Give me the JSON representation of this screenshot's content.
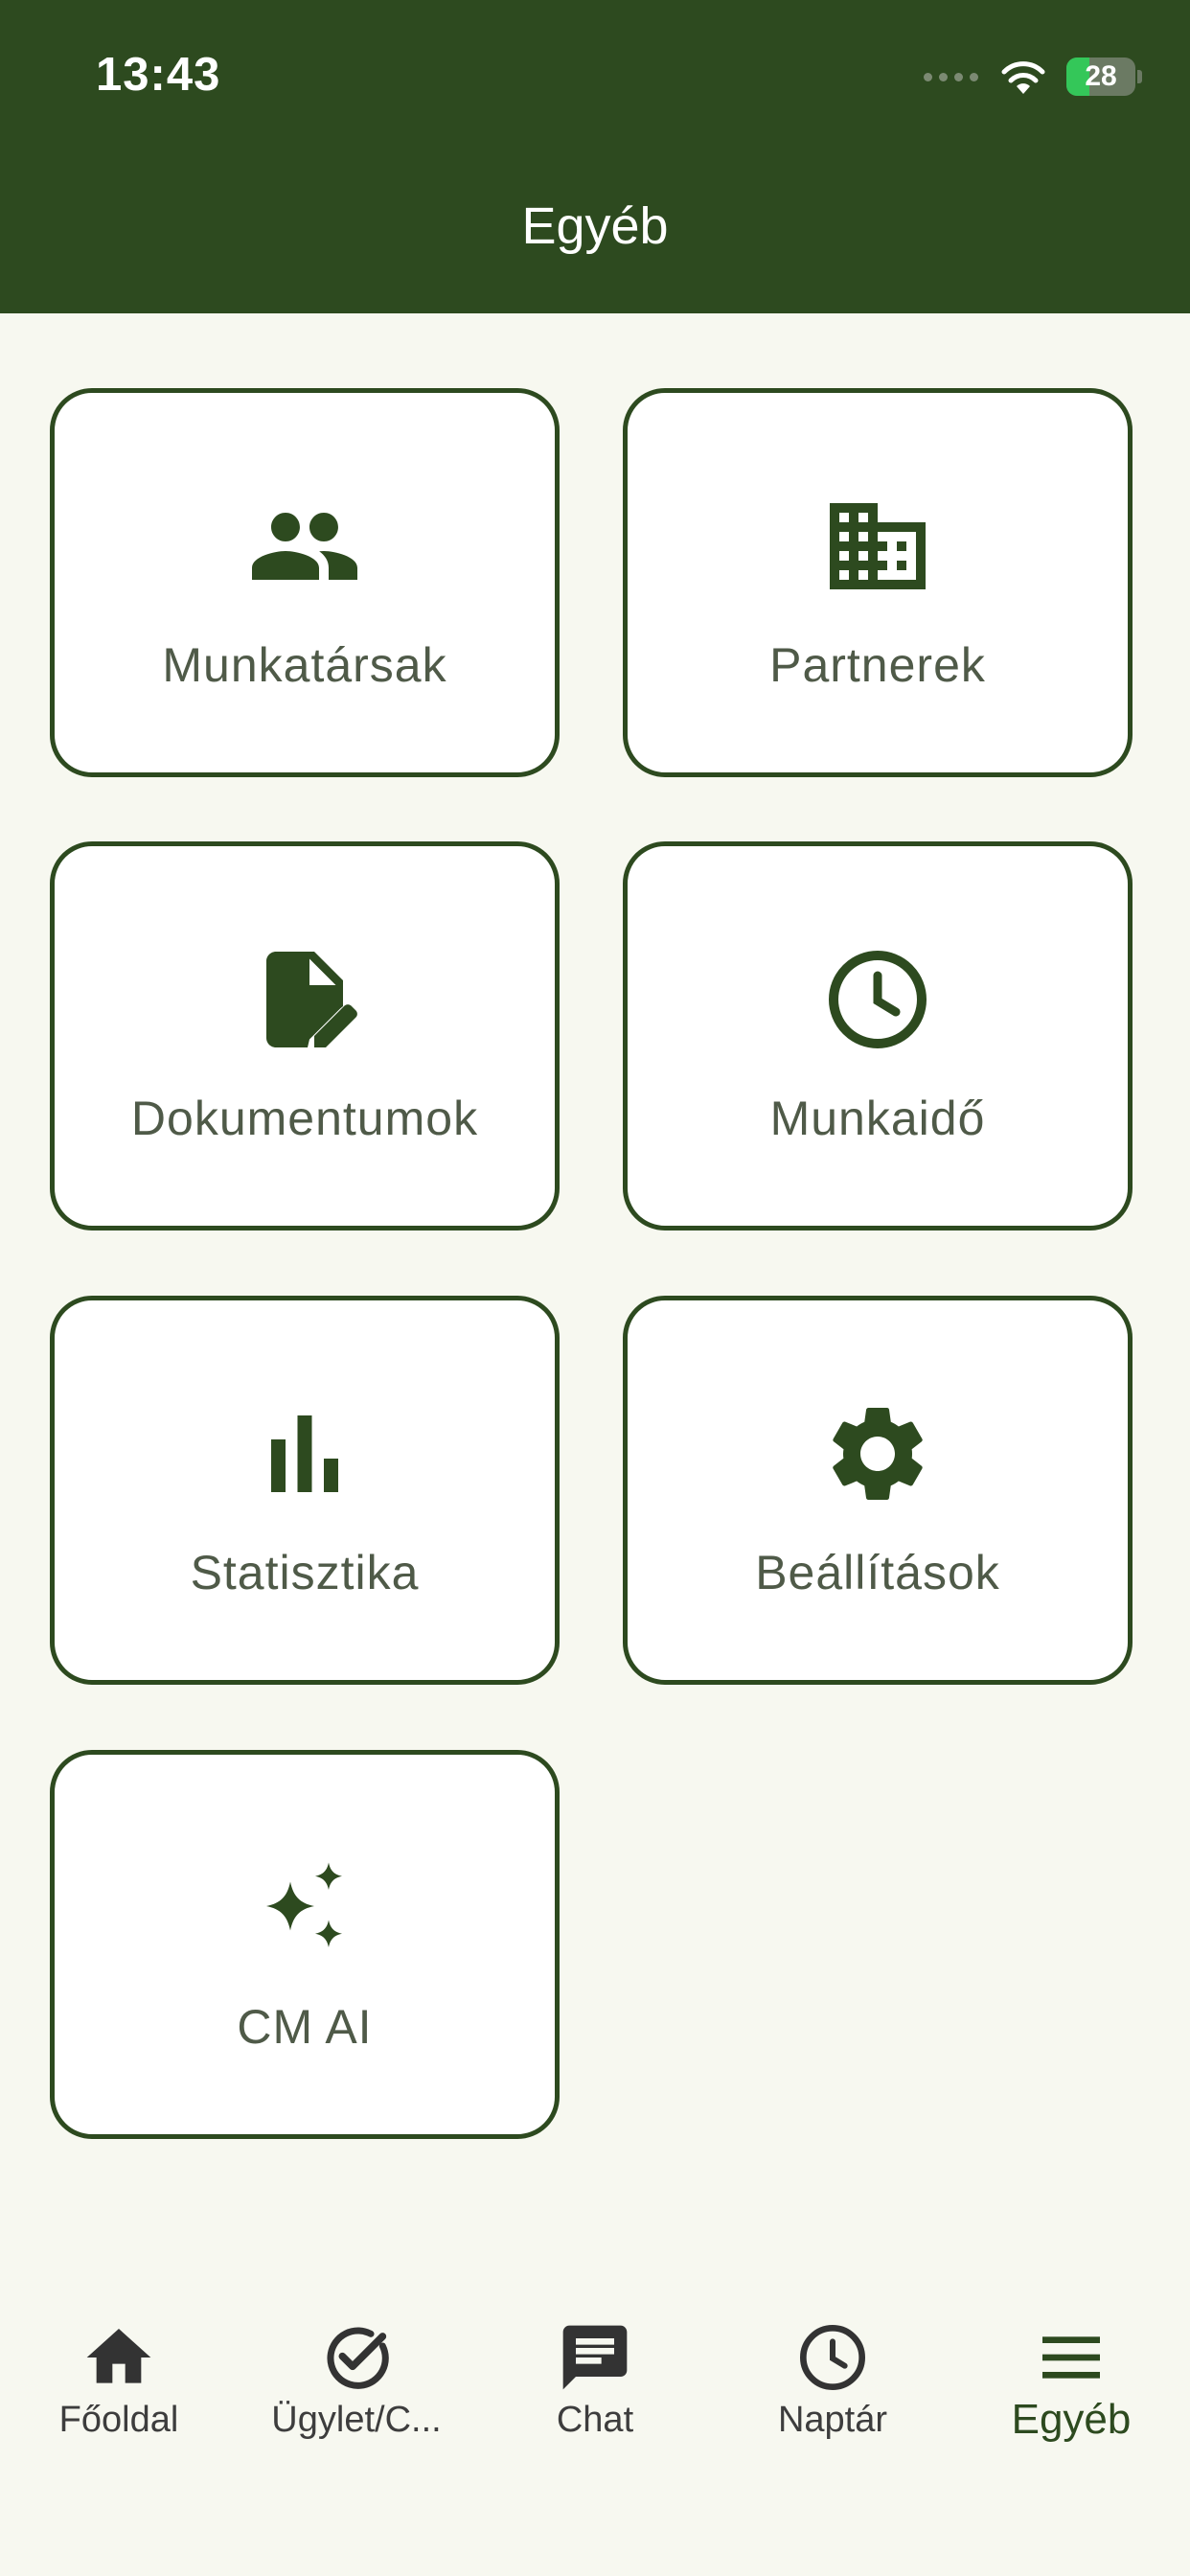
{
  "status_bar": {
    "time": "13:43",
    "battery": "28"
  },
  "header": {
    "title": "Egyéb"
  },
  "tiles": [
    {
      "label": "Munkatársak",
      "icon": "people-icon"
    },
    {
      "label": "Partnerek",
      "icon": "building-icon"
    },
    {
      "label": "Dokumentumok",
      "icon": "document-edit-icon"
    },
    {
      "label": "Munkaidő",
      "icon": "clock-icon"
    },
    {
      "label": "Statisztika",
      "icon": "bar-chart-icon"
    },
    {
      "label": "Beállítások",
      "icon": "gear-icon"
    },
    {
      "label": "CM AI",
      "icon": "sparkles-icon"
    }
  ],
  "bottom_nav": [
    {
      "label": "Főoldal",
      "icon": "home-icon"
    },
    {
      "label": "Ügylet/C...",
      "icon": "check-circle-icon"
    },
    {
      "label": "Chat",
      "icon": "chat-icon"
    },
    {
      "label": "Naptár",
      "icon": "clock-icon"
    },
    {
      "label": "Egyéb",
      "icon": "menu-icon",
      "active": true
    }
  ],
  "colors": {
    "primary": "#2d4a1f",
    "background": "#f7f8f0",
    "label": "#4f5a48"
  }
}
